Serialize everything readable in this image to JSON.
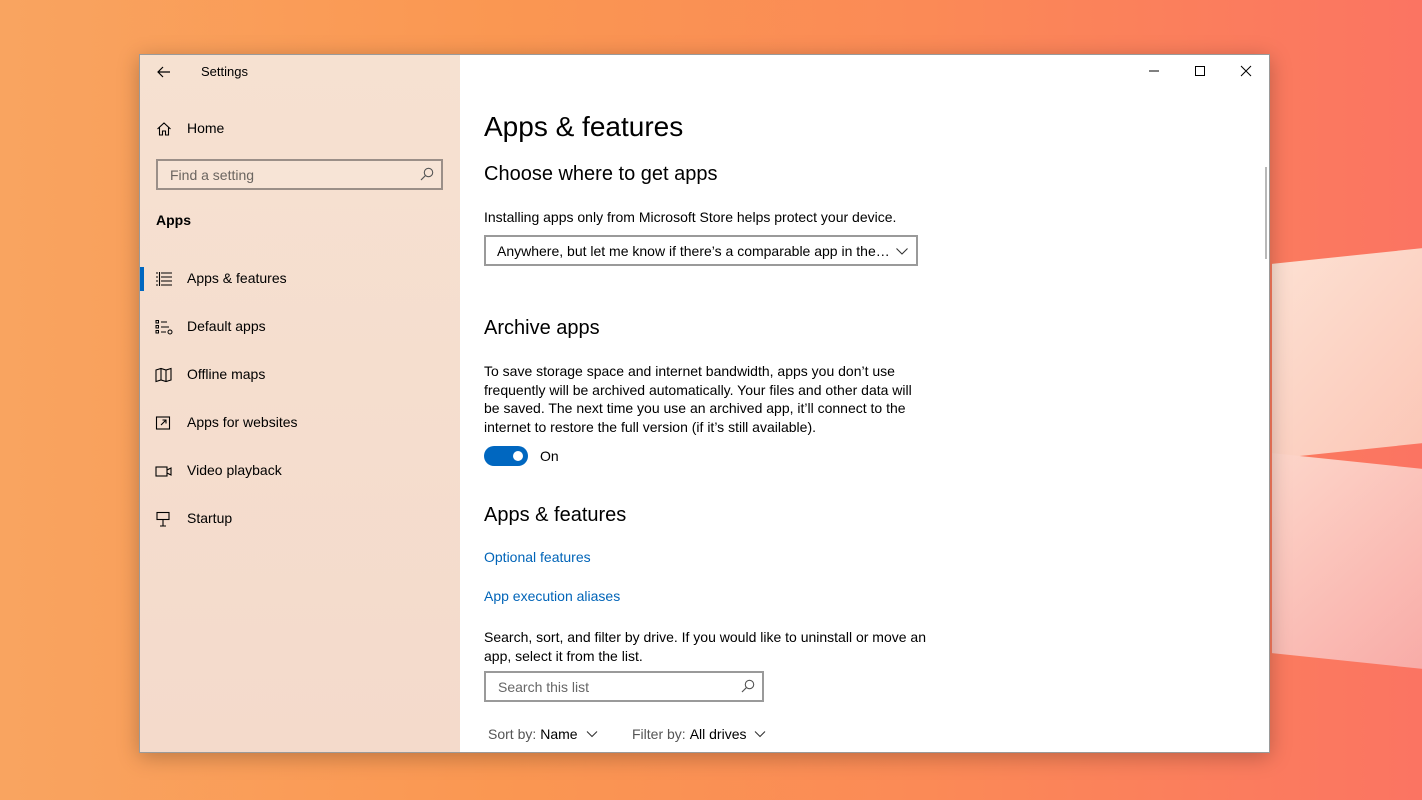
{
  "window": {
    "title": "Settings"
  },
  "sidebar": {
    "home_label": "Home",
    "search_placeholder": "Find a setting",
    "section_label": "Apps",
    "items": [
      {
        "label": "Apps & features",
        "icon": "list-icon",
        "active": true
      },
      {
        "label": "Default apps",
        "icon": "default-apps-icon",
        "active": false
      },
      {
        "label": "Offline maps",
        "icon": "map-icon",
        "active": false
      },
      {
        "label": "Apps for websites",
        "icon": "open-external-icon",
        "active": false
      },
      {
        "label": "Video playback",
        "icon": "video-icon",
        "active": false
      },
      {
        "label": "Startup",
        "icon": "startup-icon",
        "active": false
      }
    ]
  },
  "main": {
    "page_title": "Apps & features",
    "choose": {
      "heading": "Choose where to get apps",
      "description": "Installing apps only from Microsoft Store helps protect your device.",
      "dropdown_value": "Anywhere, but let me know if there’s a comparable app in the…"
    },
    "archive": {
      "heading": "Archive apps",
      "description": "To save storage space and internet bandwidth, apps you don’t use frequently will be archived automatically. Your files and other data will be saved. The next time you use an archived app, it’ll connect to the internet to restore the full version (if it’s still available).",
      "toggle_label": "On",
      "toggle_state": true
    },
    "apps": {
      "heading": "Apps & features",
      "link_optional": "Optional features",
      "link_aliases": "App execution aliases",
      "description": "Search, sort, and filter by drive. If you would like to uninstall or move an app, select it from the list.",
      "search_placeholder": "Search this list",
      "sort_label": "Sort by:",
      "sort_value": "Name",
      "filter_label": "Filter by:",
      "filter_value": "All drives"
    }
  },
  "colors": {
    "accent": "#0067c0",
    "link": "#0064b8",
    "sidebar_bg": "#f5dece"
  }
}
